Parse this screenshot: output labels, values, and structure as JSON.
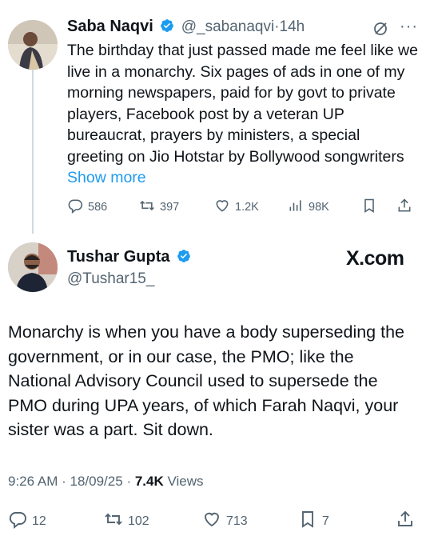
{
  "tweet1": {
    "name": "Saba Naqvi",
    "handle": "@_sabanaqvi",
    "separator": "·",
    "time": "14h",
    "text": "The birthday that just passed made me feel like we live in a monarchy. Six pages of ads in one of my morning newspapers, paid for by govt to private players, Facebook post by a veteran UP bureaucrat, prayers by ministers, a special greeting on Jio Hotstar by Bollywood songwriters",
    "show_more": "Show more",
    "replies": "586",
    "reposts": "397",
    "likes": "1.2K",
    "views": "98K"
  },
  "tweet2": {
    "name": "Tushar Gupta",
    "handle": "@Tushar15_",
    "text": "Monarchy is when you have a body superseding the government, or in our case, the PMO; like the National Advisory Council used to supersede the PMO during UPA years, of which Farah Naqvi, your sister was a part. Sit down.",
    "time": "9:26 AM",
    "date": "18/09/25",
    "views_count": "7.4K",
    "views_label": "Views",
    "replies": "12",
    "reposts": "102",
    "likes": "713",
    "bookmarks": "7"
  },
  "watermark": "X.com",
  "colors": {
    "accent": "#1d9bf0",
    "muted": "#536471",
    "text": "#0f1419"
  }
}
